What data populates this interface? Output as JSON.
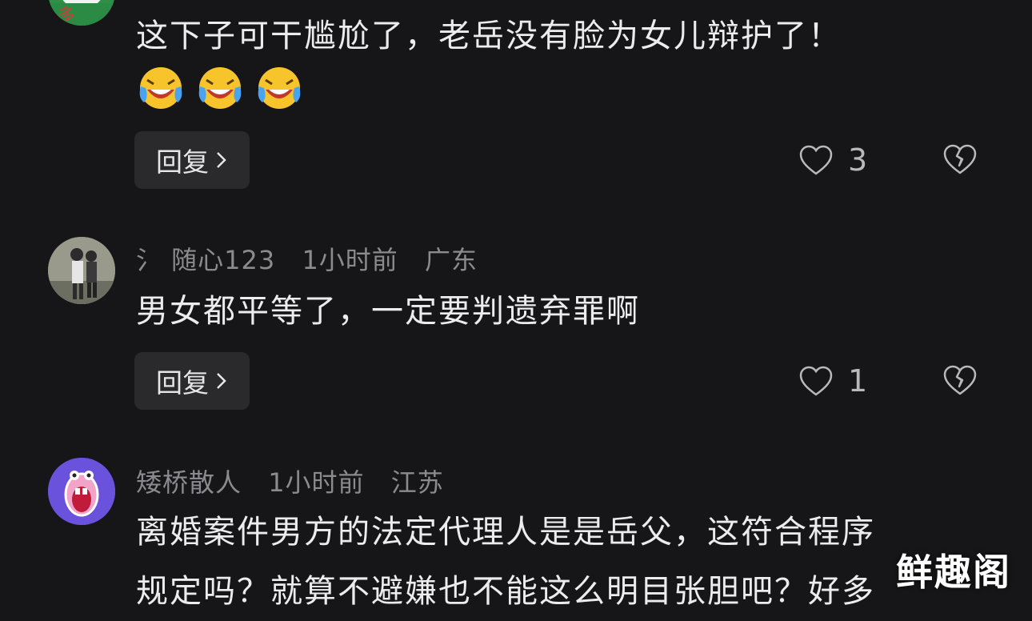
{
  "comments": [
    {
      "username": "",
      "time": "",
      "location": "",
      "text": "这下子可干尴尬了，老岳没有脸为女儿辩护了！",
      "emoji_count": 3,
      "reply_label": "回复",
      "likes": "3"
    },
    {
      "username": "氵 随心123",
      "time": "1小时前",
      "location": "广东",
      "text": "男女都平等了，一定要判遗弃罪啊",
      "reply_label": "回复",
      "likes": "1"
    },
    {
      "username": "矮桥散人",
      "time": "1小时前",
      "location": "江苏",
      "text_line1": "离婚案件男方的法定代理人是是岳父，这符合程序",
      "text_line2": "规定吗？就算不避嫌也不能这么明目张胆吧？好多"
    }
  ],
  "icons": {
    "like": "heart-outline-icon",
    "dislike": "broken-heart-icon",
    "reply_chevron": "chevron-right-icon",
    "emoji": "laughing-crying-emoji-icon"
  },
  "watermark": "鲜趣阁"
}
